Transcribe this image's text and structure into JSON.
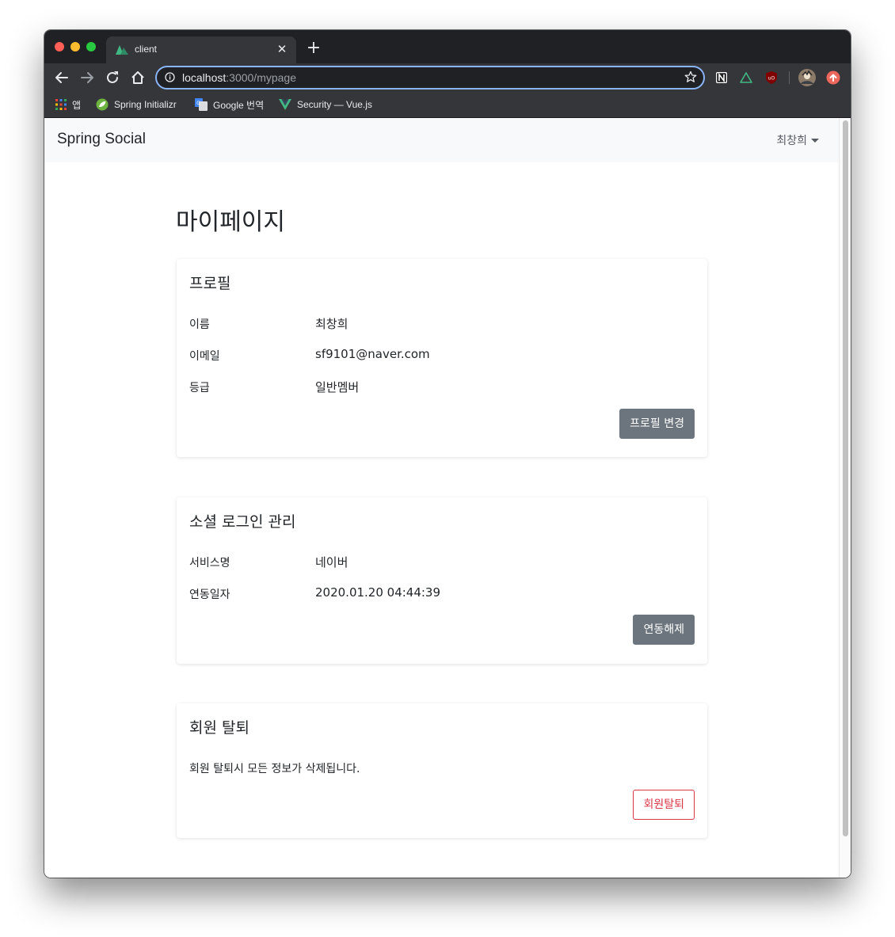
{
  "browser": {
    "tab_title": "client",
    "url_host": "localhost",
    "url_rest": ":3000/mypage",
    "bookmarks": [
      {
        "label": "앱",
        "icon": "apps-grid-icon"
      },
      {
        "label": "Spring Initializr",
        "icon": "spring-leaf-icon"
      },
      {
        "label": "Google 번역",
        "icon": "google-translate-icon"
      },
      {
        "label": "Security — Vue.js",
        "icon": "vue-logo-icon"
      }
    ]
  },
  "navbar": {
    "brand": "Spring Social",
    "user_name": "최창희"
  },
  "page": {
    "title": "마이페이지"
  },
  "profile": {
    "title": "프로필",
    "rows": [
      {
        "label": "이름",
        "value": "최창희"
      },
      {
        "label": "이메일",
        "value": "sf9101@naver.com"
      },
      {
        "label": "등급",
        "value": "일반멤버"
      }
    ],
    "button": "프로필 변경"
  },
  "social": {
    "title": "소셜 로그인 관리",
    "rows": [
      {
        "label": "서비스명",
        "value": "네이버"
      },
      {
        "label": "연동일자",
        "value": "2020.01.20 04:44:39"
      }
    ],
    "button": "연동해제"
  },
  "withdraw": {
    "title": "회원 탈퇴",
    "text": "회원 탈퇴시 모든 정보가 삭제됩니다.",
    "button": "회원탈퇴"
  },
  "colors": {
    "secondary": "#6c757d",
    "danger": "#dc3545",
    "navbar_bg": "#f8f9fa",
    "omnibox_focus": "#8ab4f8"
  }
}
